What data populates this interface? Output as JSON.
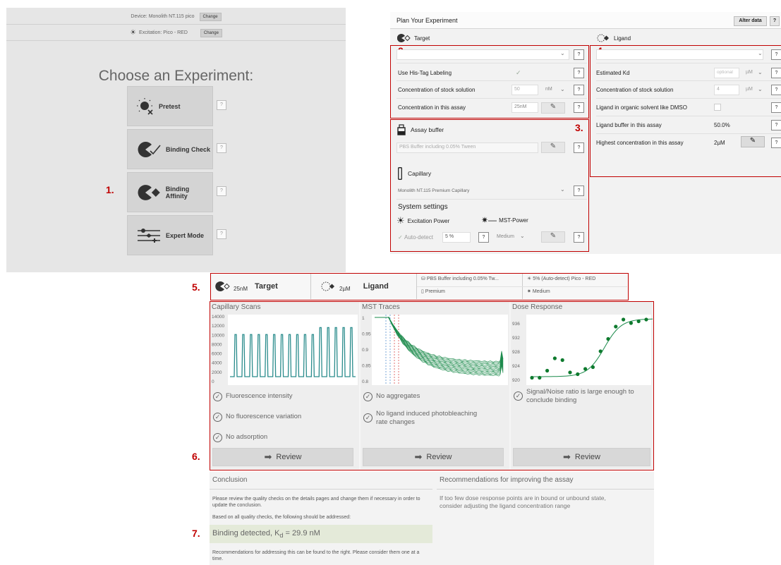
{
  "annotations": {
    "n1": "1.",
    "n2": "2.",
    "n3": "3.",
    "n4": "4.",
    "n5": "5.",
    "n6": "6.",
    "n7": "7."
  },
  "chooser": {
    "device_label": "Device: Monolith NT.115 pico",
    "device_change": "Change",
    "excitation_label": "Excitation: Pico - RED",
    "excitation_change": "Change",
    "title": "Choose an Experiment:",
    "options": [
      {
        "label": "Pretest",
        "icon": "pretest-icon"
      },
      {
        "label": "Binding Check",
        "icon": "binding-check-icon"
      },
      {
        "label": "Binding Affinity",
        "icon": "binding-affinity-icon"
      },
      {
        "label": "Expert Mode",
        "icon": "sliders-icon"
      }
    ],
    "help": "?"
  },
  "plan": {
    "title": "Plan Your Experiment",
    "alter_button": "Alter data",
    "help": "?",
    "target": {
      "header": "Target",
      "his_tag": "Use His-Tag Labeling",
      "stock_label": "Concentration of stock solution",
      "stock_value": "50",
      "stock_unit": "nM",
      "assay_label": "Concentration in this assay",
      "assay_value": "25nM"
    },
    "buffer": {
      "header": "Assay buffer",
      "value": "PBS Buffer including 0.05% Tween",
      "capillary_header": "Capillary",
      "capillary_value": "Monolith NT.115 Premium Capillary",
      "system_settings": "System settings",
      "excitation_power": "Excitation Power",
      "mst_power": "MST-Power",
      "auto_detect": "Auto-detect",
      "percent": "5 %",
      "medium": "Medium"
    },
    "ligand": {
      "header": "Ligand",
      "kd_label": "Estimated Kd",
      "kd_placeholder": "optional",
      "kd_unit": "µM",
      "stock_label": "Concentration of stock solution",
      "stock_value": "4",
      "stock_unit": "µM",
      "dmso_label": "Ligand in organic solvent like DMSO",
      "buffer_label": "Ligand buffer in this assay",
      "buffer_value": "50.0%",
      "highest_label": "Highest concentration in this assay",
      "highest_value": "2µM"
    }
  },
  "summary": {
    "target_conc": "25nM",
    "target_label": "Target",
    "ligand_conc": "2µM",
    "ligand_label": "Ligand",
    "buffer": "PBS Buffer including 0.05% Tw...",
    "capillary": "Premium",
    "excitation": "5% (Auto-detect) Pico - RED",
    "mst": "Medium"
  },
  "quality": {
    "capillary": {
      "title": "Capillary Scans",
      "checks": [
        "Fluorescence intensity",
        "No fluorescence variation",
        "No adsorption"
      ],
      "review": "Review"
    },
    "mst": {
      "title": "MST Traces",
      "checks": [
        "No aggregates",
        "No ligand induced photobleaching rate changes"
      ],
      "review": "Review"
    },
    "dose": {
      "title": "Dose Response",
      "checks": [
        "Signal/Noise ratio is large enough to conclude binding"
      ],
      "review": "Review"
    }
  },
  "chart_data": [
    {
      "type": "bar",
      "title": "Capillary Scans",
      "ylim": [
        0,
        14000
      ],
      "yticks": [
        "14000",
        "12000",
        "10000",
        "8000",
        "6000",
        "4000",
        "2000",
        "0"
      ],
      "peaks": 16,
      "peak_values": [
        10000,
        10000,
        10000,
        10000,
        10000,
        10000,
        10000,
        10000,
        10000,
        10000,
        10000,
        11500,
        11500,
        11500,
        11500,
        11500
      ]
    },
    {
      "type": "line",
      "title": "MST Traces",
      "ylim": [
        0.8,
        1.0
      ],
      "yticks": [
        "1",
        "0.95",
        "0.9",
        "0.85",
        "0.8"
      ],
      "series_count": 12
    },
    {
      "type": "scatter",
      "title": "Dose Response",
      "ylim": [
        920,
        938
      ],
      "yticks": [
        "936",
        "932",
        "928",
        "924",
        "920"
      ],
      "points": [
        [
          1,
          920.5
        ],
        [
          2,
          920.5
        ],
        [
          3,
          922.5
        ],
        [
          4,
          926
        ],
        [
          5,
          925.5
        ],
        [
          6,
          922
        ],
        [
          7,
          921.5
        ],
        [
          8,
          923
        ],
        [
          9,
          923.5
        ],
        [
          10,
          928
        ],
        [
          11,
          931.5
        ],
        [
          12,
          935
        ],
        [
          13,
          937
        ],
        [
          14,
          936
        ],
        [
          15,
          936.5
        ],
        [
          16,
          937
        ]
      ]
    }
  ],
  "conclusion": {
    "title": "Conclusion",
    "text1": "Please review the quality checks on the details pages and change them if necessary in order to update the conclusion.",
    "text2": "Based on all quality checks, the following should be addressed:",
    "result_prefix": "Binding detected, K",
    "result_sub": "d",
    "result_suffix": " = 29.9 nM",
    "text3": "Recommendations for addressing this can be found to the right. Please consider them one at a time.",
    "rec_title": "Recommendations for improving the assay",
    "rec_text": "If too few dose response points are in bound or unbound state, consider adjusting the ligand concentration range"
  },
  "colors": {
    "accent_red": "#c00000",
    "trace_green": "#1a8a4a"
  }
}
